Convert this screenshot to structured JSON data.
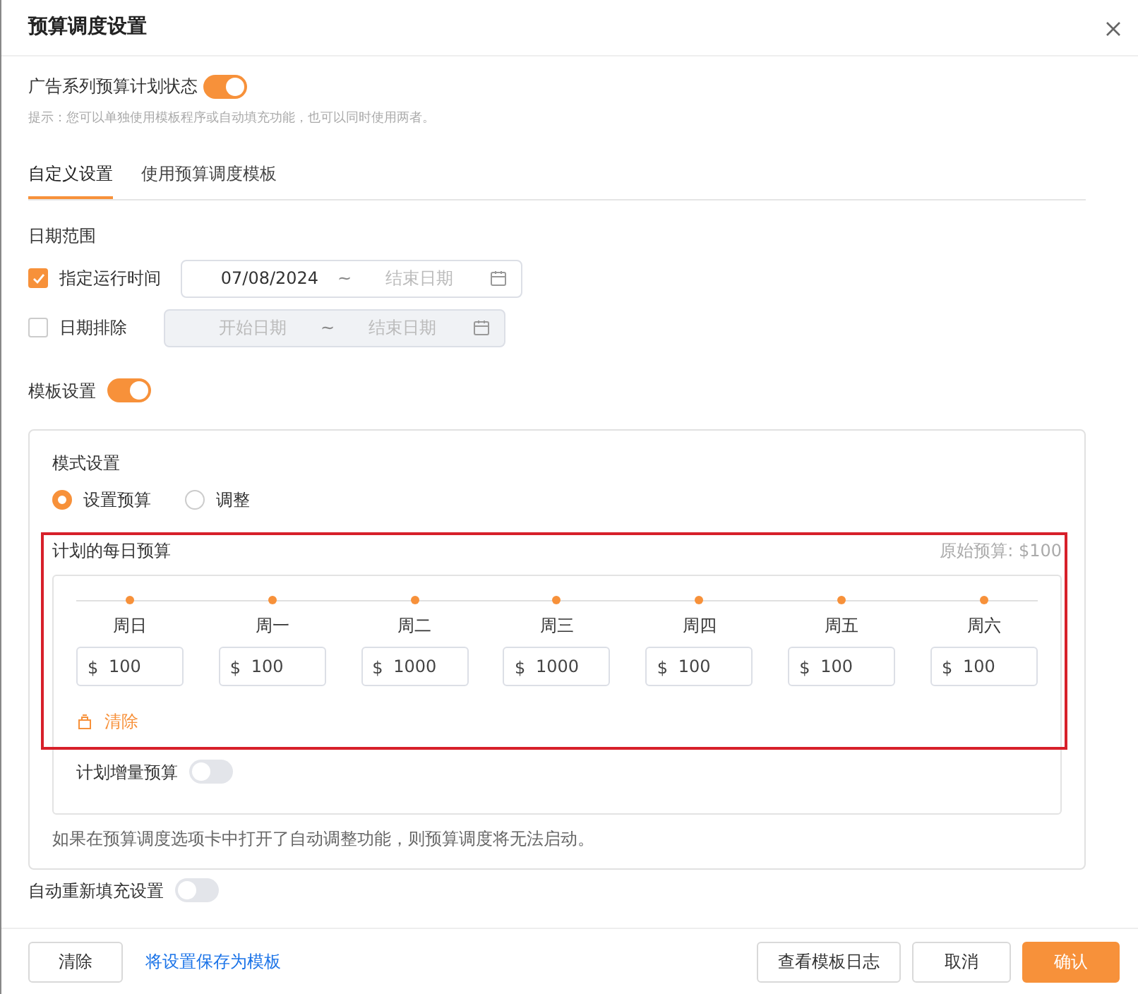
{
  "dialog": {
    "title": "预算调度设置"
  },
  "campaign_status": {
    "label": "广告系列预算计划状态",
    "on": true
  },
  "hint": "提示：您可以单独使用模板程序或自动填充功能，也可以同时使用两者。",
  "tabs": [
    {
      "label": "自定义设置",
      "selected": true
    },
    {
      "label": "使用预算调度模板",
      "selected": false
    }
  ],
  "date_range": {
    "title": "日期范围",
    "rows": [
      {
        "label": "指定运行时间",
        "checked": true,
        "disabled": false,
        "start": {
          "value": "07/08/2024"
        },
        "separator": "~",
        "end": {
          "placeholder": "结束日期"
        }
      },
      {
        "label": "日期排除",
        "checked": false,
        "disabled": true,
        "start": {
          "placeholder": "开始日期"
        },
        "separator": "~",
        "end": {
          "placeholder": "结束日期"
        }
      }
    ]
  },
  "template_settings": {
    "label": "模板设置",
    "on": true
  },
  "mode": {
    "title": "模式设置",
    "options": [
      {
        "label": "设置预算",
        "selected": true
      },
      {
        "label": "调整",
        "selected": false
      }
    ]
  },
  "daily_budget": {
    "title": "计划的每日预算",
    "original": "原始预算: $100",
    "clear": "清除",
    "days": [
      {
        "day": "周日",
        "currency": "$",
        "value": "100"
      },
      {
        "day": "周一",
        "currency": "$",
        "value": "100"
      },
      {
        "day": "周二",
        "currency": "$",
        "value": "1000"
      },
      {
        "day": "周三",
        "currency": "$",
        "value": "1000"
      },
      {
        "day": "周四",
        "currency": "$",
        "value": "100"
      },
      {
        "day": "周五",
        "currency": "$",
        "value": "100"
      },
      {
        "day": "周六",
        "currency": "$",
        "value": "100"
      }
    ]
  },
  "incremental": {
    "label": "计划增量预算",
    "on": false
  },
  "note": "如果在预算调度选项卡中打开了自动调整功能，则预算调度将无法启动。",
  "auto_refill": {
    "label": "自动重新填充设置",
    "on": false
  },
  "footer": {
    "clear": "清除",
    "save_link": "将设置保存为模板",
    "log": "查看模板日志",
    "cancel": "取消",
    "confirm": "确认"
  }
}
